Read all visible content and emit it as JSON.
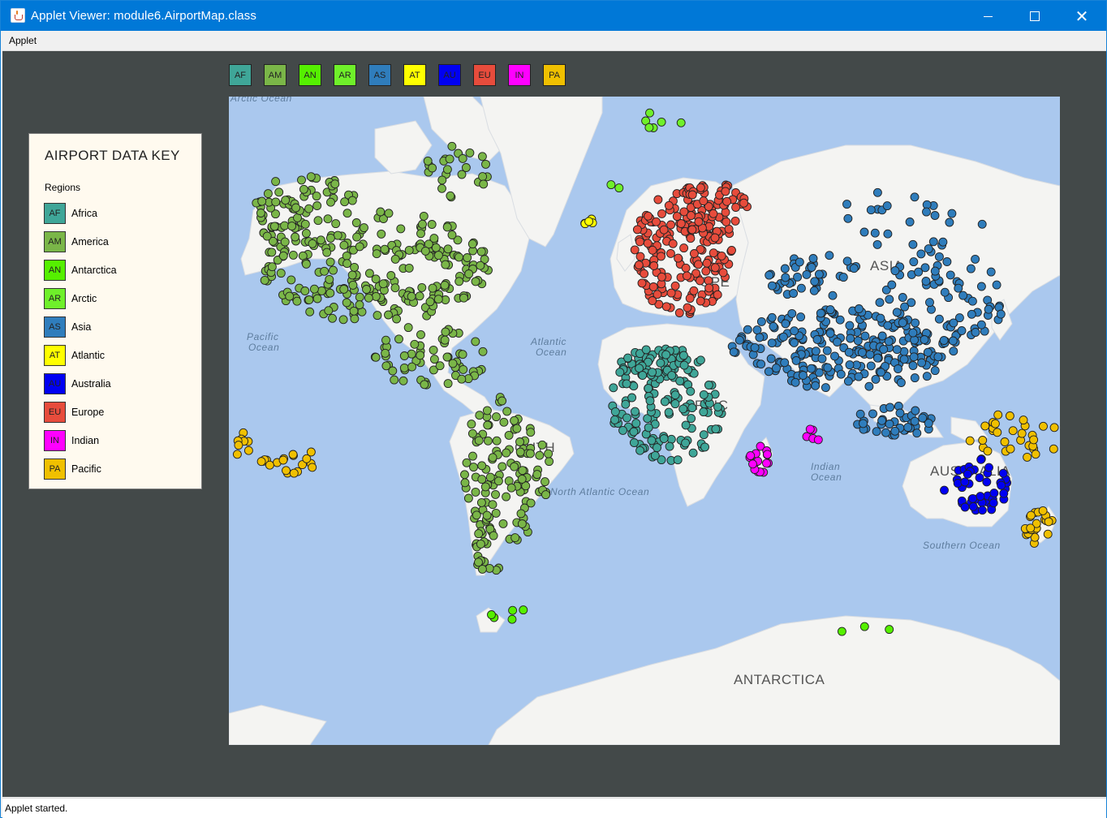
{
  "window": {
    "title": "Applet Viewer: module6.AirportMap.class",
    "minimize_icon": "minimize-icon",
    "maximize_icon": "maximize-icon",
    "close_icon": "close-icon",
    "close_glyph": "✕"
  },
  "menu": {
    "items": [
      "Applet"
    ]
  },
  "filters": [
    {
      "code": "AF",
      "color": "#3fa698"
    },
    {
      "code": "AM",
      "color": "#7ab648"
    },
    {
      "code": "AN",
      "color": "#55f000"
    },
    {
      "code": "AR",
      "color": "#6ff02a"
    },
    {
      "code": "AS",
      "color": "#2f7dbc"
    },
    {
      "code": "AT",
      "color": "#ffff00"
    },
    {
      "code": "AU",
      "color": "#0000f2"
    },
    {
      "code": "EU",
      "color": "#e74c3c"
    },
    {
      "code": "IN",
      "color": "#ff00ff"
    },
    {
      "code": "PA",
      "color": "#f0c000"
    }
  ],
  "key": {
    "title": "AIRPORT DATA KEY",
    "subtitle": "Regions",
    "regions": [
      {
        "code": "AF",
        "name": "Africa",
        "color": "#3fa698"
      },
      {
        "code": "AM",
        "name": "America",
        "color": "#7ab648"
      },
      {
        "code": "AN",
        "name": "Antarctica",
        "color": "#55f000"
      },
      {
        "code": "AR",
        "name": "Arctic",
        "color": "#6ff02a"
      },
      {
        "code": "AS",
        "name": "Asia",
        "color": "#2f7dbc"
      },
      {
        "code": "AT",
        "name": "Atlantic",
        "color": "#ffff00"
      },
      {
        "code": "AU",
        "name": "Australia",
        "color": "#0000f2"
      },
      {
        "code": "EU",
        "name": "Europe",
        "color": "#e74c3c"
      },
      {
        "code": "IN",
        "name": "Indian",
        "color": "#ff00ff"
      },
      {
        "code": "PA",
        "name": "Pacific",
        "color": "#f0c000"
      }
    ]
  },
  "map": {
    "ocean_color": "#aac8ee",
    "land_color": "#f4f4f2",
    "ocean_labels": [
      "Arctic Ocean",
      "Pacific",
      "Ocean",
      "Atlantic",
      "Ocean",
      "North Atlantic Ocean",
      "Indian",
      "Ocean",
      "Southern Ocean"
    ],
    "region_labels": [
      "ASIA",
      "OPE",
      "AFRIC",
      "OUTH",
      "AUSTRALIA",
      "ANTARCTICA"
    ]
  },
  "status": {
    "text": "Applet started."
  }
}
